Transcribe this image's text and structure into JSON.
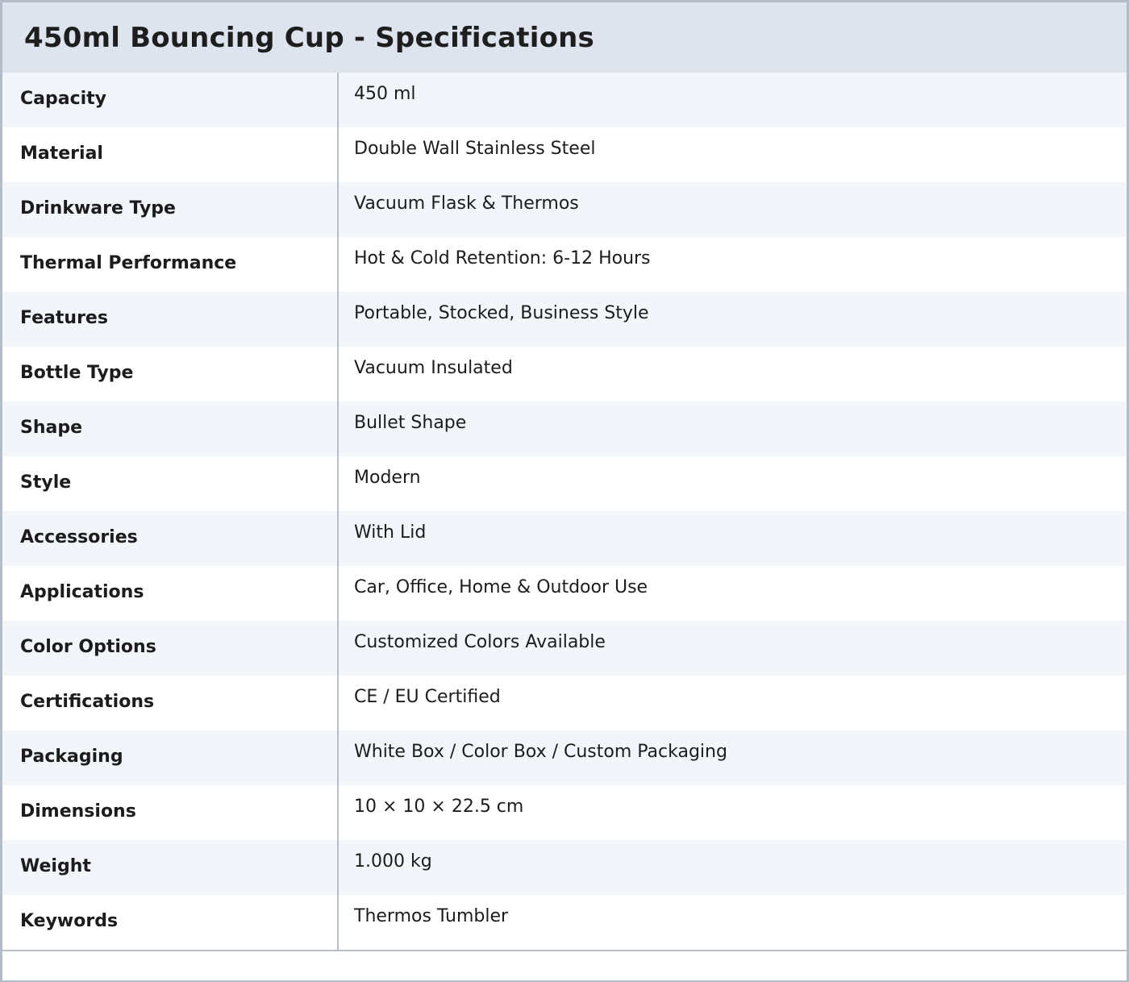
{
  "title": "450ml Bouncing Cup - Specifications",
  "specs": [
    {
      "label": "Capacity",
      "value": "450 ml"
    },
    {
      "label": "Material",
      "value": "Double Wall Stainless Steel"
    },
    {
      "label": "Drinkware Type",
      "value": "Vacuum Flask & Thermos"
    },
    {
      "label": "Thermal Performance",
      "value": "Hot & Cold Retention: 6-12 Hours"
    },
    {
      "label": "Features",
      "value": "Portable, Stocked, Business Style"
    },
    {
      "label": "Bottle Type",
      "value": "Vacuum Insulated"
    },
    {
      "label": "Shape",
      "value": "Bullet Shape"
    },
    {
      "label": "Style",
      "value": "Modern"
    },
    {
      "label": "Accessories",
      "value": "With Lid"
    },
    {
      "label": "Applications",
      "value": "Car, Office, Home & Outdoor Use"
    },
    {
      "label": "Color Options",
      "value": "Customized Colors Available"
    },
    {
      "label": "Certifications",
      "value": "CE / EU Certified"
    },
    {
      "label": "Packaging",
      "value": "White Box / Color Box / Custom Packaging"
    },
    {
      "label": "Dimensions",
      "value": "10 × 10 × 22.5 cm"
    },
    {
      "label": "Weight",
      "value": "1.000 kg"
    },
    {
      "label": "Keywords",
      "value": "Thermos Tumbler"
    }
  ]
}
